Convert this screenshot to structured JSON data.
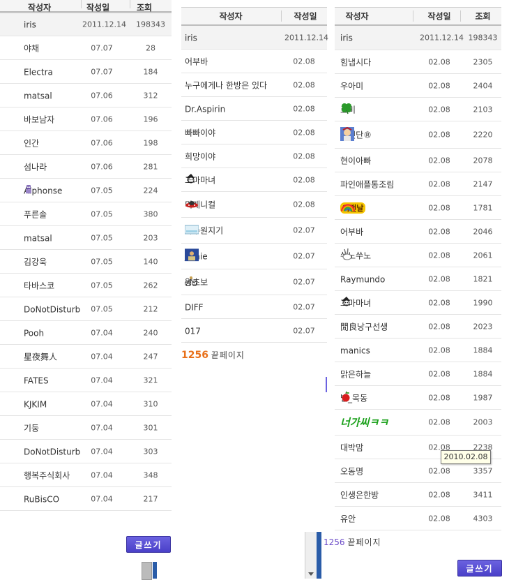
{
  "left_board": {
    "header": {
      "author": "작성자",
      "date": "작성일",
      "views": "조회"
    },
    "rows": [
      {
        "author": "iris",
        "date": "2011.12.14",
        "views": "198343",
        "notice": true
      },
      {
        "author": "야채",
        "date": "07.07",
        "views": "28"
      },
      {
        "author": "Electra",
        "date": "07.07",
        "views": "184"
      },
      {
        "author": "matsal",
        "date": "07.06",
        "views": "312"
      },
      {
        "author": "바보남자",
        "date": "07.06",
        "views": "196"
      },
      {
        "author": "인간",
        "date": "07.06",
        "views": "198"
      },
      {
        "author": "섬나라",
        "date": "07.06",
        "views": "281"
      },
      {
        "author": "Alphonse",
        "date": "07.05",
        "views": "224",
        "icon": "robot-icon"
      },
      {
        "author": "푸른솔",
        "date": "07.05",
        "views": "380"
      },
      {
        "author": "matsal",
        "date": "07.05",
        "views": "203"
      },
      {
        "author": "김강욱",
        "date": "07.05",
        "views": "140"
      },
      {
        "author": "타바스코",
        "date": "07.05",
        "views": "262"
      },
      {
        "author": "DoNotDisturb",
        "date": "07.05",
        "views": "212"
      },
      {
        "author": "Pooh",
        "date": "07.04",
        "views": "240"
      },
      {
        "author": "星夜舞人",
        "date": "07.04",
        "views": "247"
      },
      {
        "author": "FATES",
        "date": "07.04",
        "views": "321"
      },
      {
        "author": "KJKIM",
        "date": "07.04",
        "views": "310"
      },
      {
        "author": "기둥",
        "date": "07.04",
        "views": "301"
      },
      {
        "author": "DoNotDisturb",
        "date": "07.04",
        "views": "303"
      },
      {
        "author": "행복주식회사",
        "date": "07.04",
        "views": "348"
      },
      {
        "author": "RuBisCO",
        "date": "07.04",
        "views": "217"
      }
    ],
    "write_button": "글쓰기"
  },
  "middle_board": {
    "header": {
      "author": "작성자",
      "date": "작성일"
    },
    "rows": [
      {
        "author": "iris",
        "date": "2011.12.14",
        "notice": true
      },
      {
        "author": "어부바",
        "date": "02.08"
      },
      {
        "author": "누구에게나 한방은 있다",
        "date": "02.08"
      },
      {
        "author": "Dr.Aspirin",
        "date": "02.08"
      },
      {
        "author": "빠빠이야",
        "date": "02.08"
      },
      {
        "author": "희망이야",
        "date": "02.08"
      },
      {
        "author": "꼬마마녀",
        "date": "02.08",
        "icon": "witch-icon"
      },
      {
        "author": "미케니컬",
        "date": "02.08",
        "icon": "ufo-icon"
      },
      {
        "author": "과수원지기",
        "date": "02.07",
        "icon": "landscape-icon"
      },
      {
        "author": "jinnie",
        "date": "02.07",
        "icon": "photo-icon"
      },
      {
        "author": "왕초보",
        "date": "02.07",
        "icon": "bicycle-icon"
      },
      {
        "author": "DIFF",
        "date": "02.07"
      },
      {
        "author": "017",
        "date": "02.07"
      }
    ],
    "pager": {
      "count": "1256",
      "text": "끝페이지"
    }
  },
  "right_board": {
    "header": {
      "author": "작성자",
      "date": "작성일",
      "views": "조회"
    },
    "rows": [
      {
        "author": "iris",
        "date": "2011.12.14",
        "views": "198343",
        "notice": true
      },
      {
        "author": "힘냅시다",
        "date": "02.08",
        "views": "2305"
      },
      {
        "author": "우아미",
        "date": "02.08",
        "views": "2404"
      },
      {
        "author": "로미",
        "date": "02.08",
        "views": "2103",
        "icon": "clover-icon"
      },
      {
        "author": "로켓단®",
        "date": "02.08",
        "views": "2220",
        "icon": "cartoon-icon"
      },
      {
        "author": "현이아빠",
        "date": "02.08",
        "views": "2078"
      },
      {
        "author": "파인애플통조림",
        "date": "02.08",
        "views": "2147"
      },
      {
        "author": "",
        "date": "02.08",
        "views": "1781",
        "icon": "rainbow-icon",
        "badge": "어랜날"
      },
      {
        "author": "어부바",
        "date": "02.08",
        "views": "2046"
      },
      {
        "author": "쑤노쑤노",
        "date": "02.08",
        "views": "2061",
        "icon": "rabbit-icon"
      },
      {
        "author": "Raymundo",
        "date": "02.08",
        "views": "1821"
      },
      {
        "author": "꼬마마녀",
        "date": "02.08",
        "views": "1990",
        "icon": "witch-icon"
      },
      {
        "author": "閒良낭구선생",
        "date": "02.08",
        "views": "2023"
      },
      {
        "author": "manics",
        "date": "02.08",
        "views": "1884"
      },
      {
        "author": "맑은하늘",
        "date": "02.08",
        "views": "1884"
      },
      {
        "author": "별_목동",
        "date": "02.08",
        "views": "1987",
        "icon": "apple-icon"
      },
      {
        "author": "",
        "date": "02.08",
        "views": "2003",
        "handwritten": "너가씨ㅋㅋ"
      },
      {
        "author": "대박맘",
        "date": "02.08",
        "views": "2238"
      },
      {
        "author": "오동명",
        "date": "02.08",
        "views": "3357"
      },
      {
        "author": "인생은한방",
        "date": "02.08",
        "views": "3411"
      },
      {
        "author": "유안",
        "date": "02.08",
        "views": "4303"
      }
    ],
    "pager": {
      "count": "1256",
      "text": "끝페이지"
    },
    "write_button": "글쓰기",
    "tooltip": "2010.02.08"
  }
}
